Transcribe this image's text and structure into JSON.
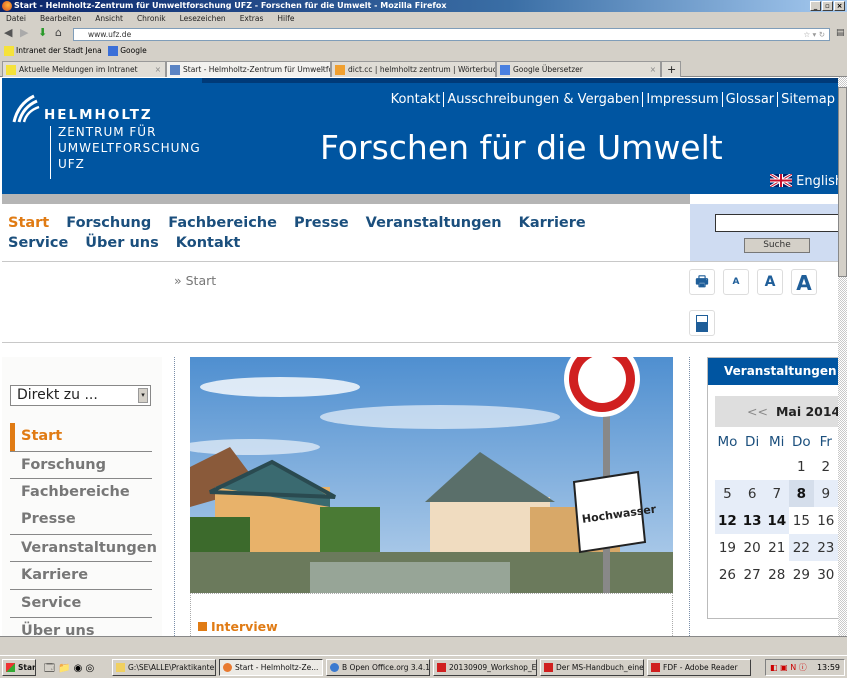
{
  "window": {
    "title": "Start - Helmholtz-Zentrum für Umweltforschung UFZ - Forschen für die Umwelt - Mozilla Firefox"
  },
  "menu": [
    "Datei",
    "Bearbeiten",
    "Ansicht",
    "Chronik",
    "Lesezeichen",
    "Extras",
    "Hilfe"
  ],
  "url": "www.ufz.de",
  "bookmarks": [
    "Intranet der Stadt Jena",
    "Google"
  ],
  "tabs": [
    {
      "label": "Aktuelle Meldungen im Intranet",
      "active": false
    },
    {
      "label": "Start - Helmholtz-Zentrum für Umweltfors...",
      "active": true
    },
    {
      "label": "dict.cc | helmholtz zentrum | Wörterbuch ...",
      "active": false
    },
    {
      "label": "Google Übersetzer",
      "active": false
    }
  ],
  "header": {
    "logo": {
      "line1": "HELMHOLTZ",
      "line2": "ZENTRUM FÜR",
      "line3": "UMWELTFORSCHUNG",
      "line4": "UFZ"
    },
    "toplinks": [
      "Kontakt",
      "Ausschreibungen & Vergaben",
      "Impressum",
      "Glossar",
      "Sitemap"
    ],
    "slogan": "Forschen für die Umwelt",
    "language": "English"
  },
  "mainnav": [
    "Start",
    "Forschung",
    "Fachbereiche",
    "Presse",
    "Veranstaltungen",
    "Karriere",
    "Service",
    "Über uns",
    "Kontakt"
  ],
  "search": {
    "value": "",
    "button": "Suche"
  },
  "breadcrumb": "» Start",
  "tools": {
    "font_small": "A",
    "font_normal": "A",
    "font_large": "A"
  },
  "sidebar": {
    "direkt": "Direkt zu ...",
    "items": [
      "Start",
      "Forschung",
      "Fachbereiche",
      "Presse",
      "Veranstaltungen",
      "Karriere",
      "Service",
      "Über uns"
    ]
  },
  "teaser": {
    "label": "Interview",
    "sign_text": "Hochwasser"
  },
  "calendar": {
    "title": "Veranstaltungen",
    "prev": "<<",
    "month": "Mai 2014",
    "days": [
      "Mo",
      "Di",
      "Mi",
      "Do",
      "Fr"
    ],
    "weeks": [
      [
        "",
        "",
        "",
        "1",
        "2"
      ],
      [
        "5",
        "6",
        "7",
        "8",
        "9"
      ],
      [
        "12",
        "13",
        "14",
        "15",
        "16"
      ],
      [
        "19",
        "20",
        "21",
        "22",
        "23"
      ],
      [
        "26",
        "27",
        "28",
        "29",
        "30"
      ]
    ]
  },
  "taskbar": {
    "start": "Start",
    "items": [
      "G:\\SE\\ALLE\\Praktikanten ...",
      "Start - Helmholtz-Ze...",
      "B Open Office.org 3.4.1",
      "20130909_Workshop_Es...",
      "Der MS-Handbuch_einen...",
      "FDF - Adobe Reader"
    ],
    "clock": "13:59"
  },
  "colors": {
    "brand_blue": "#0055a1",
    "accent_orange": "#e07b14",
    "nav_blue": "#1b4f7d"
  }
}
